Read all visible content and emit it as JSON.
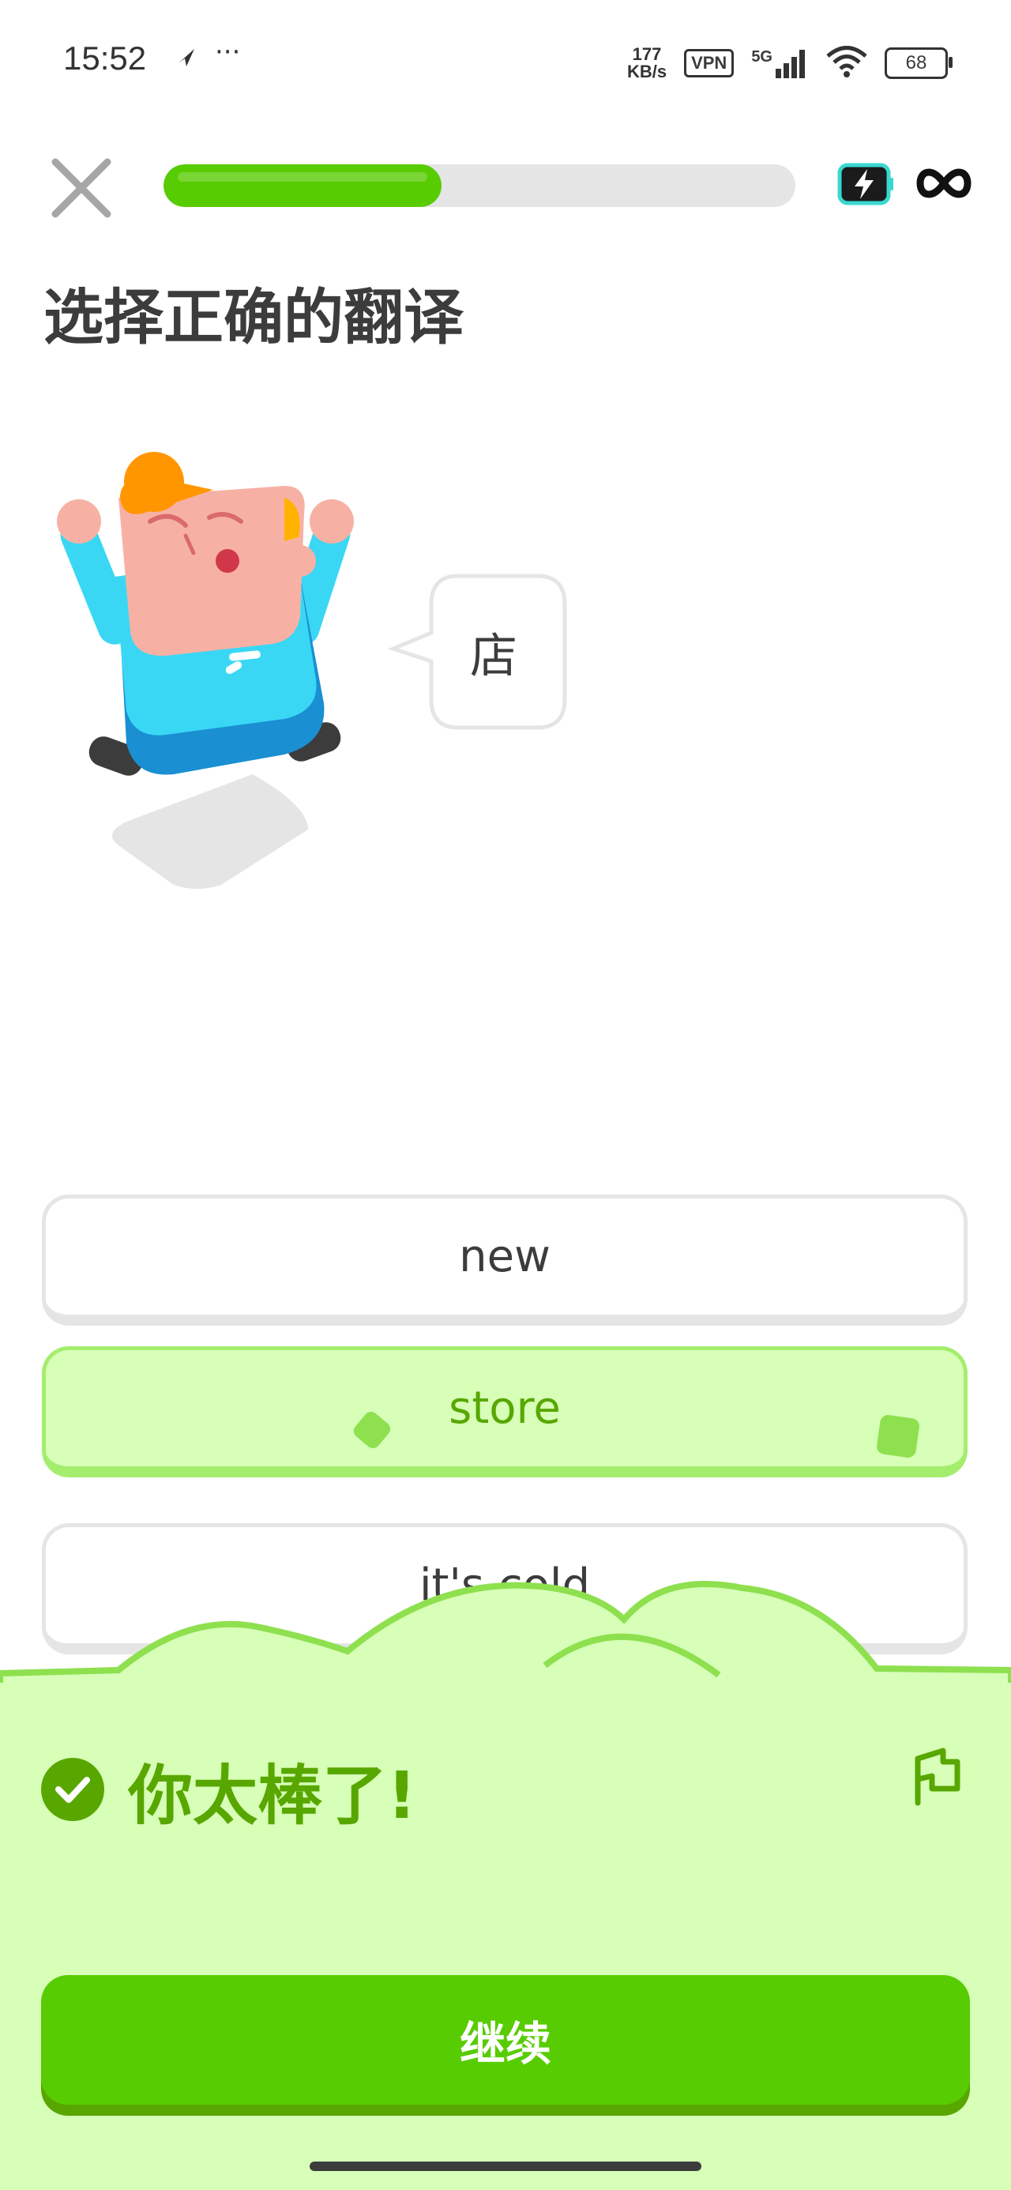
{
  "status_bar": {
    "time": "15:52",
    "extra_dots": "···",
    "net_speed_value": "177",
    "net_speed_unit": "KB/s",
    "vpn": "VPN",
    "network": "5G",
    "battery": "68"
  },
  "lesson": {
    "progress_fraction": 0.44,
    "progress_color": "#58cc02",
    "accent_color": "#58cc02",
    "energy_icon": "energy-icon",
    "hearts_icon": "infinity-icon"
  },
  "challenge": {
    "title": "选择正确的翻译",
    "prompt_word": "店"
  },
  "options": [
    {
      "label": "new",
      "selected": false
    },
    {
      "label": "store",
      "selected": true
    },
    {
      "label": "it's cold",
      "selected": false
    }
  ],
  "feedback": {
    "message": "你太棒了!",
    "continue_label": "继续",
    "success_color": "#58a700",
    "sheet_color": "#d7ffb8"
  }
}
